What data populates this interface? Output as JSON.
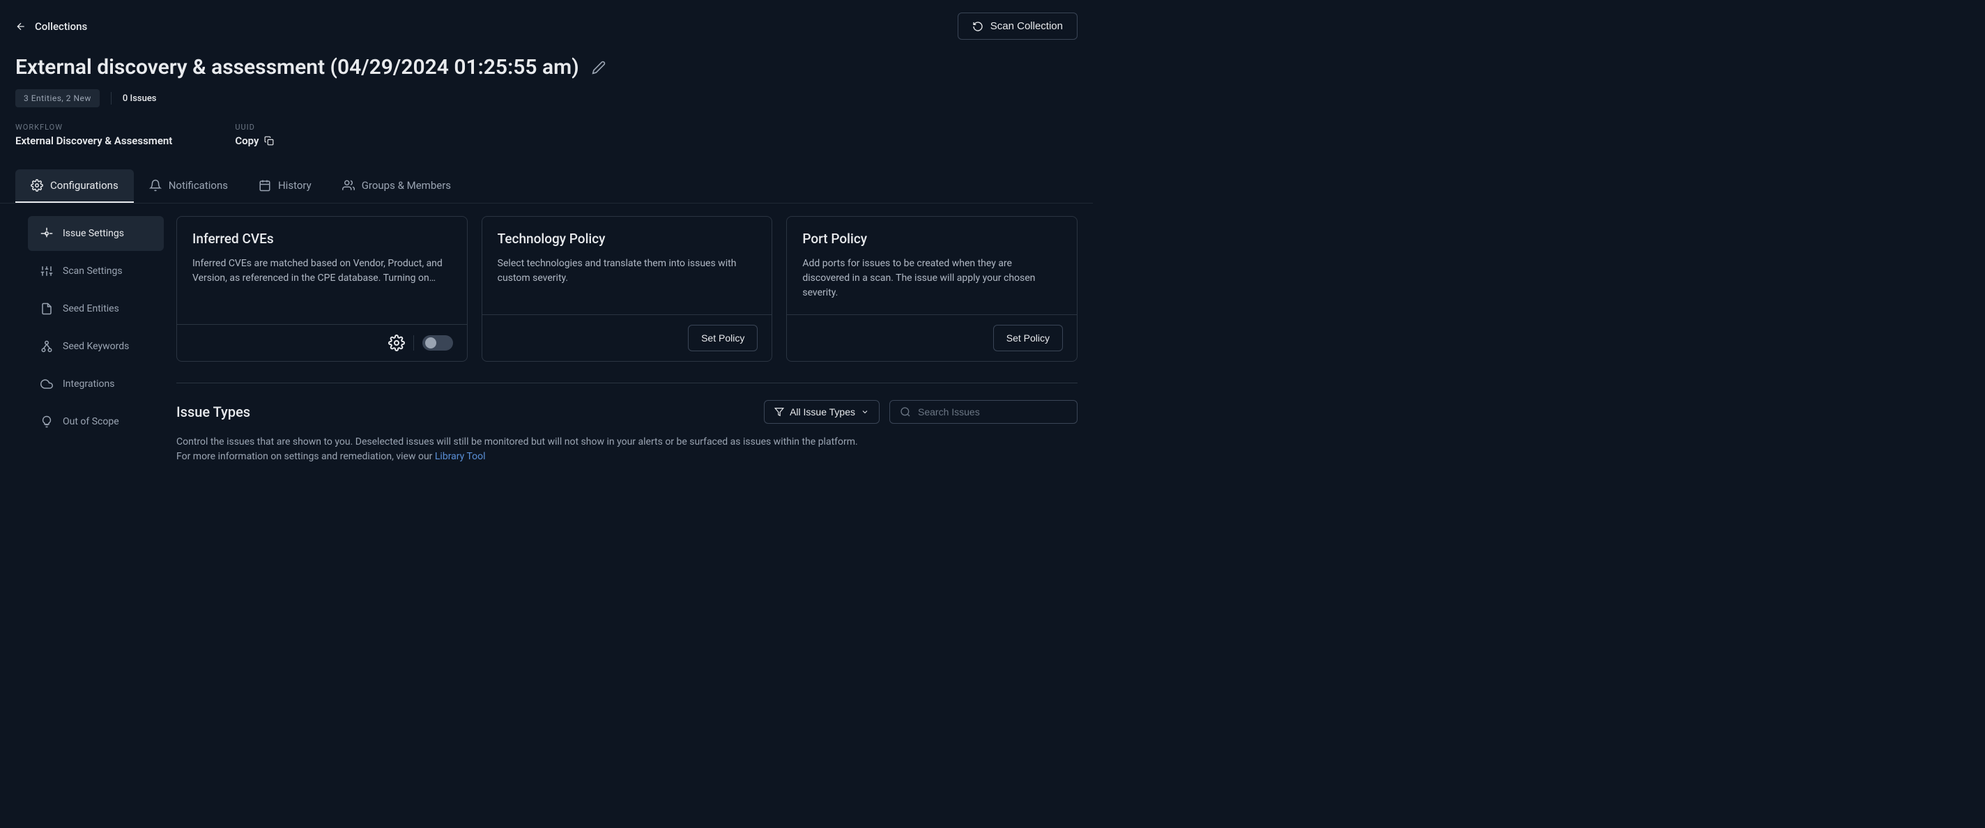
{
  "nav": {
    "back_label": "Collections",
    "scan_button": "Scan Collection"
  },
  "header": {
    "title": "External discovery & assessment (04/29/2024 01:25:55 am)",
    "entities_badge": "3 Entities, 2 New",
    "issues_count": "0 Issues"
  },
  "details": {
    "workflow_label": "WORKFLOW",
    "workflow_value": "External Discovery & Assessment",
    "uuid_label": "UUID",
    "copy_label": "Copy"
  },
  "tabs": [
    {
      "id": "configurations",
      "label": "Configurations",
      "active": true
    },
    {
      "id": "notifications",
      "label": "Notifications",
      "active": false
    },
    {
      "id": "history",
      "label": "History",
      "active": false
    },
    {
      "id": "groups",
      "label": "Groups & Members",
      "active": false
    }
  ],
  "sidebar": [
    {
      "id": "issue-settings",
      "label": "Issue Settings",
      "active": true
    },
    {
      "id": "scan-settings",
      "label": "Scan Settings",
      "active": false
    },
    {
      "id": "seed-entities",
      "label": "Seed Entities",
      "active": false
    },
    {
      "id": "seed-keywords",
      "label": "Seed Keywords",
      "active": false
    },
    {
      "id": "integrations",
      "label": "Integrations",
      "active": false
    },
    {
      "id": "out-of-scope",
      "label": "Out of Scope",
      "active": false
    }
  ],
  "cards": {
    "inferred": {
      "title": "Inferred CVEs",
      "desc": "Inferred CVEs are matched based on Vendor, Product, and Version, as referenced in the CPE database. Turning on…"
    },
    "tech": {
      "title": "Technology Policy",
      "desc": "Select technologies and translate them into issues with custom severity.",
      "button": "Set Policy"
    },
    "port": {
      "title": "Port Policy",
      "desc": "Add ports for issues to be created when they are discovered in a scan. The issue will apply your chosen severity.",
      "button": "Set Policy"
    }
  },
  "issue_types": {
    "title": "Issue Types",
    "filter_label": "All Issue Types",
    "search_placeholder": "Search Issues",
    "desc_part1": "Control the issues that are shown to you. Deselected issues will still be monitored but will not show in your alerts or be surfaced as issues within the platform. For more information on settings and remediation, view our ",
    "link_text": "Library Tool"
  }
}
